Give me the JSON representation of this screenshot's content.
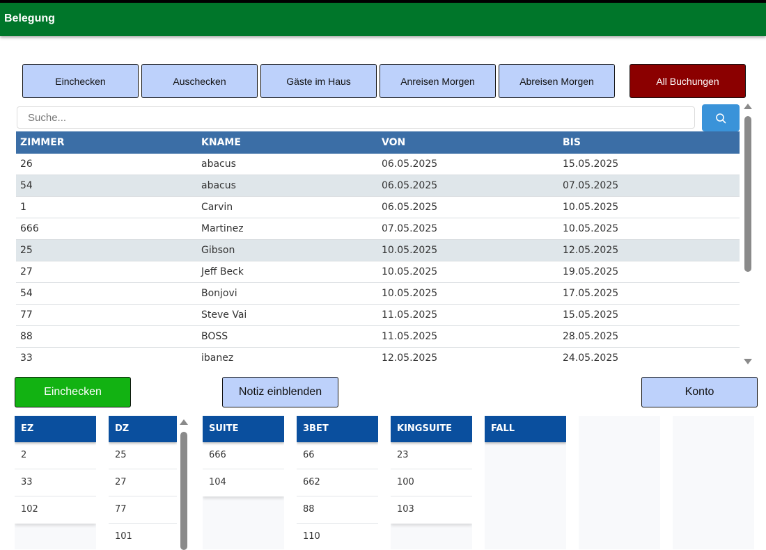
{
  "header": {
    "title": "Belegung"
  },
  "tabs": [
    {
      "label": "Einchecken"
    },
    {
      "label": "Auschecken"
    },
    {
      "label": "Gäste im Haus"
    },
    {
      "label": "Anreisen Morgen"
    },
    {
      "label": "Abreisen Morgen"
    },
    {
      "label": "All Buchungen"
    }
  ],
  "search": {
    "placeholder": "Suche...",
    "icon": "search-icon"
  },
  "table": {
    "headers": [
      "ZIMMER",
      "KNAME",
      "VON",
      "BIS"
    ],
    "rows": [
      [
        "26",
        "abacus",
        "06.05.2025",
        "15.05.2025"
      ],
      [
        "54",
        "abacus",
        "06.05.2025",
        "07.05.2025"
      ],
      [
        "1",
        "Carvin",
        "06.05.2025",
        "10.05.2025"
      ],
      [
        "666",
        "Martinez",
        "07.05.2025",
        "10.05.2025"
      ],
      [
        "25",
        "Gibson",
        "10.05.2025",
        "12.05.2025"
      ],
      [
        "27",
        "Jeff Beck",
        "10.05.2025",
        "19.05.2025"
      ],
      [
        "54",
        "Bonjovi",
        "10.05.2025",
        "17.05.2025"
      ],
      [
        "77",
        "Steve Vai",
        "11.05.2025",
        "15.05.2025"
      ],
      [
        "88",
        "BOSS",
        "11.05.2025",
        "28.05.2025"
      ],
      [
        "33",
        "ibanez",
        "12.05.2025",
        "24.05.2025"
      ]
    ]
  },
  "actions": {
    "checkin": "Einchecken",
    "note": "Notiz einblenden",
    "account": "Konto"
  },
  "rooms": {
    "ez": {
      "title": "EZ",
      "items": [
        "2",
        "33",
        "102"
      ]
    },
    "dz": {
      "title": "DZ",
      "items": [
        "25",
        "27",
        "77",
        "101"
      ]
    },
    "suite": {
      "title": "SUITE",
      "items": [
        "666",
        "104"
      ]
    },
    "bet3": {
      "title": "3BET",
      "items": [
        "66",
        "662",
        "88",
        "110"
      ]
    },
    "kingsuite": {
      "title": "KINGSUITE",
      "items": [
        "23",
        "100",
        "103"
      ]
    },
    "fall": {
      "title": "FALL",
      "items": []
    }
  },
  "colors": {
    "header": "#00762a",
    "tab": "#bdd1fb",
    "tab_active": "#8b0000",
    "table_header": "#3b6ea6",
    "room_header": "#0a4f9e",
    "checkin_button": "#12b212",
    "search_button": "#3a93d9"
  }
}
